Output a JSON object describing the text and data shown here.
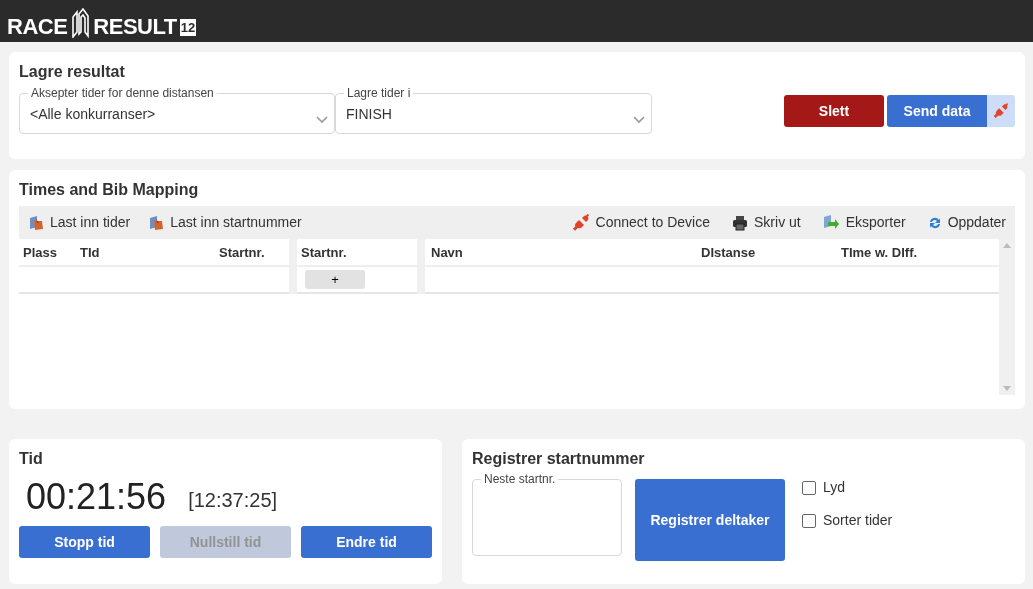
{
  "header": {
    "logo": {
      "word_1": "RACE",
      "word_2": "RESULT",
      "version": "12"
    }
  },
  "save_results": {
    "title": "Lagre resultat",
    "fields": [
      {
        "label": "Aksepter tider for denne distansen",
        "value": "<Alle konkurranser>"
      },
      {
        "label": "Lagre tider i",
        "value": "FINISH"
      }
    ],
    "buttons": [
      {
        "label": "Slett",
        "kind": "danger"
      },
      {
        "label": "Send data",
        "kind": "primary"
      }
    ]
  },
  "mapping": {
    "title": "Times and Bib Mapping",
    "toolbar_left": [
      {
        "label": "Last inn tider",
        "kind": "load"
      },
      {
        "label": "Last inn startnummer",
        "kind": "load"
      }
    ],
    "toolbar_right": [
      {
        "label": "Connect to Device",
        "kind": "plug"
      },
      {
        "label": "Skriv ut",
        "kind": "print"
      },
      {
        "label": "Eksporter",
        "kind": "export"
      },
      {
        "label": "Oppdater",
        "kind": "refresh"
      }
    ],
    "columns_left": [
      "Plass",
      "TId",
      "Startnr."
    ],
    "columns_right": [
      "Startnr.",
      "Navn",
      "DIstanse",
      "TIme w. DIff."
    ],
    "add_button": "+"
  },
  "timer": {
    "title": "Tid",
    "elapsed": "00:21:56",
    "clock": "[12:37:25]",
    "buttons": [
      {
        "label": "Stopp tid",
        "disabled": false
      },
      {
        "label": "Nullstill tid",
        "disabled": true
      },
      {
        "label": "Endre tid",
        "disabled": false
      }
    ]
  },
  "register": {
    "title": "Registrer startnummer",
    "input": {
      "label": "Neste startnr."
    },
    "button": "Registrer deltaker",
    "options": [
      {
        "label": "Lyd",
        "checked": false
      },
      {
        "label": "Sorter tider",
        "checked": false
      }
    ]
  }
}
